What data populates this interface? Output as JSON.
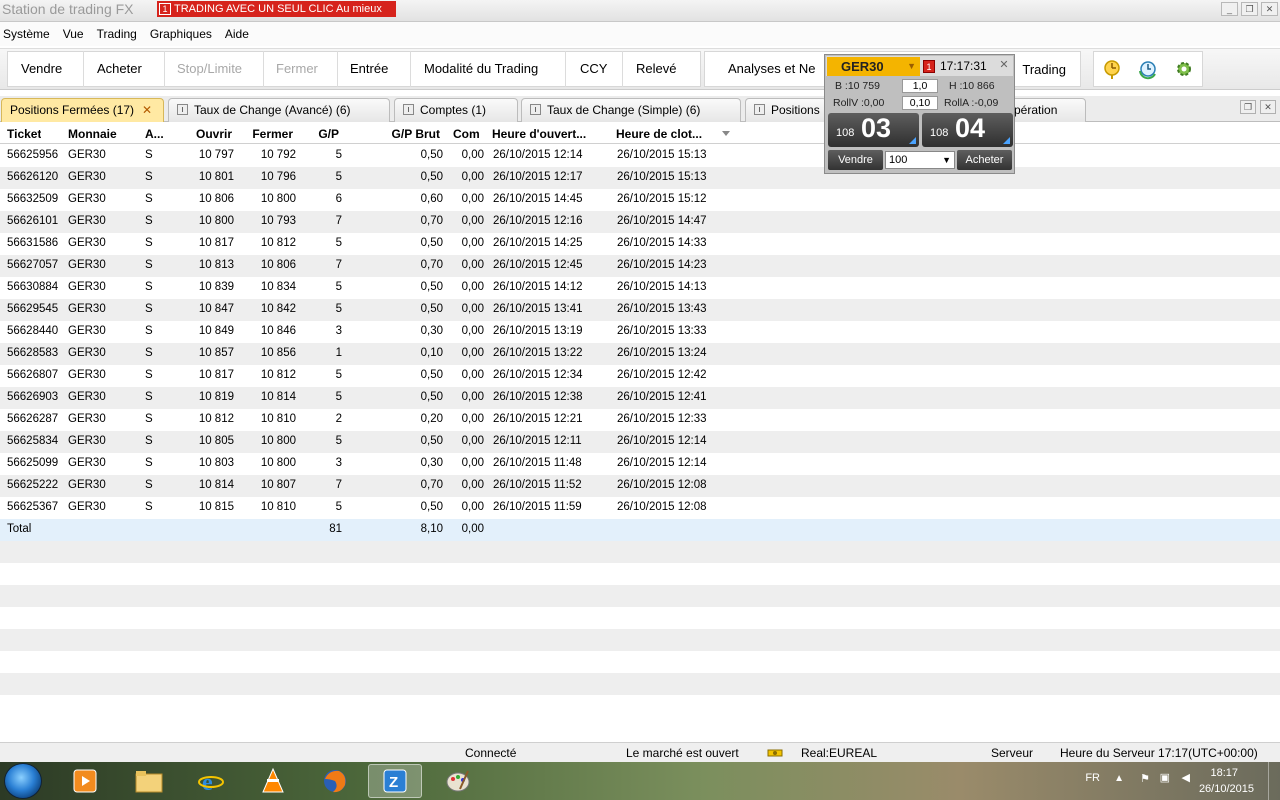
{
  "window": {
    "title": "Station de trading FX",
    "oneclick_num": "1",
    "oneclick_label": "TRADING AVEC UN SEUL CLIC Au mieux"
  },
  "menu": [
    "Système",
    "Vue",
    "Trading",
    "Graphiques",
    "Aide"
  ],
  "toolbar": {
    "buttons": [
      "Vendre",
      "Acheter",
      "Stop/Limite",
      "Fermer",
      "Entrée",
      "Modalité du Trading",
      "CCY",
      "Relevé"
    ],
    "analyses": "Analyses et Ne",
    "trading": "Trading"
  },
  "tabs": [
    {
      "label": "Positions Fermées (17)",
      "close": "✕"
    },
    {
      "label": "Taux de Change (Avancé) (6)"
    },
    {
      "label": "Comptes (1)"
    },
    {
      "label": "Taux de Change (Simple) (6)"
    },
    {
      "label": "Positions"
    },
    {
      "label": "pération"
    }
  ],
  "grid": {
    "columns": [
      "Ticket",
      "Monnaie",
      "A...",
      "Ouvrir",
      "Fermer",
      "G/P",
      "G/P Brut",
      "Com",
      "Heure d'ouvert...",
      "Heure de clot..."
    ],
    "rows": [
      [
        "56625956",
        "GER30",
        "S",
        "10 797",
        "10 792",
        "5",
        "0,50",
        "0,00",
        "26/10/2015 12:14",
        "26/10/2015 15:13"
      ],
      [
        "56626120",
        "GER30",
        "S",
        "10 801",
        "10 796",
        "5",
        "0,50",
        "0,00",
        "26/10/2015 12:17",
        "26/10/2015 15:13"
      ],
      [
        "56632509",
        "GER30",
        "S",
        "10 806",
        "10 800",
        "6",
        "0,60",
        "0,00",
        "26/10/2015 14:45",
        "26/10/2015 15:12"
      ],
      [
        "56626101",
        "GER30",
        "S",
        "10 800",
        "10 793",
        "7",
        "0,70",
        "0,00",
        "26/10/2015 12:16",
        "26/10/2015 14:47"
      ],
      [
        "56631586",
        "GER30",
        "S",
        "10 817",
        "10 812",
        "5",
        "0,50",
        "0,00",
        "26/10/2015 14:25",
        "26/10/2015 14:33"
      ],
      [
        "56627057",
        "GER30",
        "S",
        "10 813",
        "10 806",
        "7",
        "0,70",
        "0,00",
        "26/10/2015 12:45",
        "26/10/2015 14:23"
      ],
      [
        "56630884",
        "GER30",
        "S",
        "10 839",
        "10 834",
        "5",
        "0,50",
        "0,00",
        "26/10/2015 14:12",
        "26/10/2015 14:13"
      ],
      [
        "56629545",
        "GER30",
        "S",
        "10 847",
        "10 842",
        "5",
        "0,50",
        "0,00",
        "26/10/2015 13:41",
        "26/10/2015 13:43"
      ],
      [
        "56628440",
        "GER30",
        "S",
        "10 849",
        "10 846",
        "3",
        "0,30",
        "0,00",
        "26/10/2015 13:19",
        "26/10/2015 13:33"
      ],
      [
        "56628583",
        "GER30",
        "S",
        "10 857",
        "10 856",
        "1",
        "0,10",
        "0,00",
        "26/10/2015 13:22",
        "26/10/2015 13:24"
      ],
      [
        "56626807",
        "GER30",
        "S",
        "10 817",
        "10 812",
        "5",
        "0,50",
        "0,00",
        "26/10/2015 12:34",
        "26/10/2015 12:42"
      ],
      [
        "56626903",
        "GER30",
        "S",
        "10 819",
        "10 814",
        "5",
        "0,50",
        "0,00",
        "26/10/2015 12:38",
        "26/10/2015 12:41"
      ],
      [
        "56626287",
        "GER30",
        "S",
        "10 812",
        "10 810",
        "2",
        "0,20",
        "0,00",
        "26/10/2015 12:21",
        "26/10/2015 12:33"
      ],
      [
        "56625834",
        "GER30",
        "S",
        "10 805",
        "10 800",
        "5",
        "0,50",
        "0,00",
        "26/10/2015 12:11",
        "26/10/2015 12:14"
      ],
      [
        "56625099",
        "GER30",
        "S",
        "10 803",
        "10 800",
        "3",
        "0,30",
        "0,00",
        "26/10/2015 11:48",
        "26/10/2015 12:14"
      ],
      [
        "56625222",
        "GER30",
        "S",
        "10 814",
        "10 807",
        "7",
        "0,70",
        "0,00",
        "26/10/2015 11:52",
        "26/10/2015 12:08"
      ],
      [
        "56625367",
        "GER30",
        "S",
        "10 815",
        "10 810",
        "5",
        "0,50",
        "0,00",
        "26/10/2015 11:59",
        "26/10/2015 12:08"
      ]
    ],
    "total": {
      "label": "Total",
      "gp": "81",
      "gp_brut": "8,10",
      "com": "0,00"
    }
  },
  "widget": {
    "symbol": "GER30",
    "flag": "1",
    "time": "17:17:31",
    "low": "B :10 759",
    "spread": "1,0",
    "high": "H :10 866",
    "rollv": "RollV :0,00",
    "roll_value": "0,10",
    "rolla": "RollA :-0,09",
    "sell_small": "108",
    "sell_big": "03",
    "buy_small": "108",
    "buy_big": "04",
    "sell_label": "Vendre",
    "buy_label": "Acheter",
    "quantity": "100"
  },
  "status": {
    "connection": "Connecté",
    "market": "Le marché est ouvert",
    "account": "Real:EUREAL",
    "server": "Serveur",
    "server_time": "Heure du Serveur 17:17(UTC+00:00)"
  },
  "taskbar": {
    "lang": "FR",
    "time": "18:17",
    "date": "26/10/2015"
  }
}
